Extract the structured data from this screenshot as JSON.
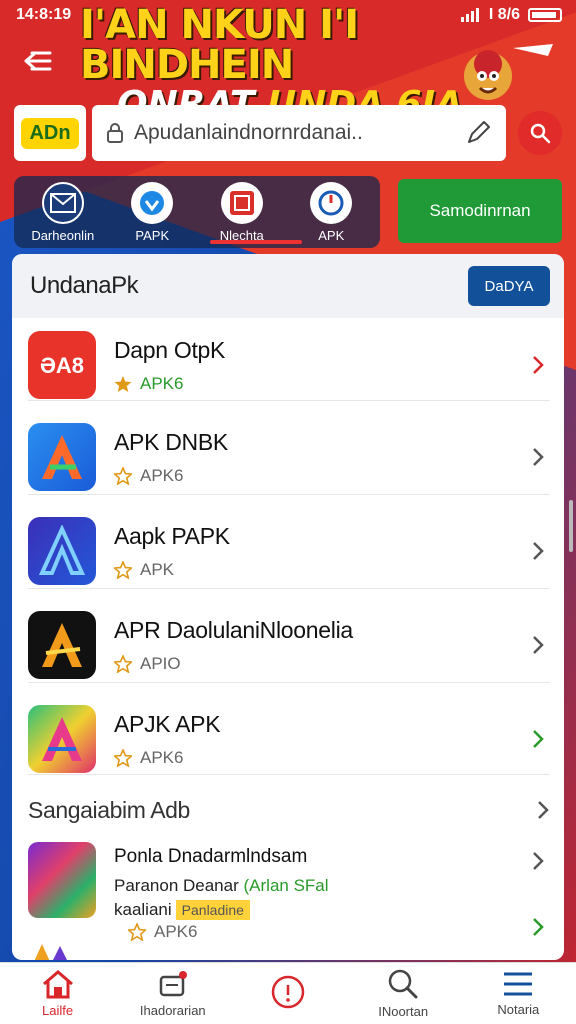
{
  "status_bar": {
    "time": "14:8:19",
    "right_text": "I 8/6"
  },
  "banner": {
    "line1": "I'AN NKUN I'I BINDHEIN",
    "line2_a": "ONRAT",
    "line2_b": "UNDA 6IA"
  },
  "search": {
    "logo": "ADn",
    "placeholder": "Apudanlaindnornrdanai.."
  },
  "categories": [
    {
      "label": "Darheonlin"
    },
    {
      "label": "PAPK"
    },
    {
      "label": "Nlechta"
    },
    {
      "label": "APK"
    }
  ],
  "green_button": "Samodinrnan",
  "list_section": {
    "title": "UndanaPk",
    "button": "DaDYA",
    "items": [
      {
        "name": "Dapn OtpK",
        "meta": "APK6"
      },
      {
        "name": "APK DNBK",
        "meta": "APK6"
      },
      {
        "name": "Aapk PAPK",
        "meta": "APK"
      },
      {
        "name": "APR DaolulaniNloonelia",
        "meta": "APIO"
      },
      {
        "name": "APJK APK",
        "meta": "APK6"
      }
    ]
  },
  "section2": {
    "title": "Sangaiabim Adb",
    "feature": {
      "name": "Ponla Dnadarmlndsam",
      "line2_a": "Paranon Deanar",
      "line2_b": "(Arlan SFal",
      "line3_a": "kaaliani",
      "badge": "Panladine",
      "meta": "APK6"
    }
  },
  "bottom_nav": [
    {
      "label": "Lailfe"
    },
    {
      "label": "Ihadorarian"
    },
    {
      "label": ""
    },
    {
      "label": "INoortan"
    },
    {
      "label": "Notaria"
    }
  ],
  "colors": {
    "accent_red": "#d8262b",
    "accent_blue": "#13509a",
    "accent_green": "#1f9a36",
    "star": "#e09a1a"
  }
}
